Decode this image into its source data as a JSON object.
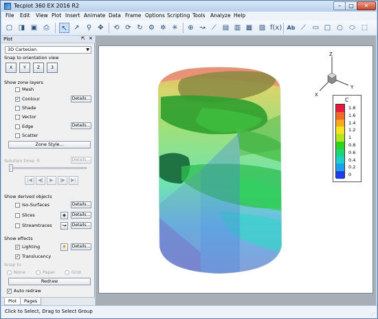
{
  "window": {
    "title": "Tecplot 360 EX 2016 R2",
    "min": "–",
    "max": "□",
    "close": "✕"
  },
  "menu": [
    "File",
    "Edit",
    "View",
    "Plot",
    "Insert",
    "Animate",
    "Data",
    "Frame",
    "Options",
    "Scripting",
    "Tools",
    "Analyze",
    "Help"
  ],
  "toolbar": {
    "text_tool": "Ab",
    "fx": "f(x)"
  },
  "panel": {
    "title": "Plot",
    "pin": "⇱",
    "close": "✕",
    "plot_type": "3D Cartesian",
    "snap_label": "Snap to orientation view",
    "orient": [
      "X",
      "Y",
      "Z",
      "3"
    ],
    "zone_layers_label": "Show zone layers",
    "layers": [
      {
        "label": "Mesh",
        "checked": ""
      },
      {
        "label": "Contour",
        "checked": "✓",
        "button": "Details..."
      },
      {
        "label": "Shade",
        "checked": ""
      },
      {
        "label": "Vector",
        "checked": ""
      },
      {
        "label": "Edge",
        "checked": "",
        "button": "Details..."
      },
      {
        "label": "Scatter",
        "checked": ""
      }
    ],
    "zone_style": "Zone Style...",
    "solution_time": "Solution time: 0",
    "solution_details": "Details...",
    "playback": [
      "|◀",
      "◀|",
      "▶",
      "|▶",
      "▶|"
    ],
    "derived_label": "Show derived objects",
    "derived": [
      {
        "label": "Iso-Surfaces",
        "checked": "",
        "button": "Details..."
      },
      {
        "label": "Slices",
        "checked": "",
        "button": "Details..."
      },
      {
        "label": "Streamtraces",
        "checked": "",
        "button": "Details..."
      }
    ],
    "effects_label": "Show effects",
    "effects": [
      {
        "label": "Lighting",
        "checked": "✓",
        "button": "Details..."
      },
      {
        "label": "Translucency",
        "checked": "✓"
      }
    ],
    "snap_to_label": "Snap to",
    "snap_options": [
      "None",
      "Paper",
      "Grid"
    ],
    "redraw": "Redraw",
    "auto_redraw": {
      "label": "Auto redraw",
      "checked": "✓"
    },
    "tabs": [
      "Plot",
      "Pages"
    ]
  },
  "axes": {
    "x": "X",
    "y": "Y",
    "z": "Z"
  },
  "legend": {
    "title": "C",
    "values": [
      "1.8",
      "1.6",
      "1.4",
      "1.2",
      "1",
      "0.8",
      "0.6",
      "0.4",
      "0.2",
      "0"
    ],
    "colors": [
      "#e8193a",
      "#f06a2a",
      "#f6a81e",
      "#f4e51e",
      "#b5e51e",
      "#2ed31e",
      "#1ed67a",
      "#1ecfcf",
      "#1e9fe9",
      "#1e3fe8"
    ]
  },
  "status": "Click to Select, Drag to Select Group"
}
